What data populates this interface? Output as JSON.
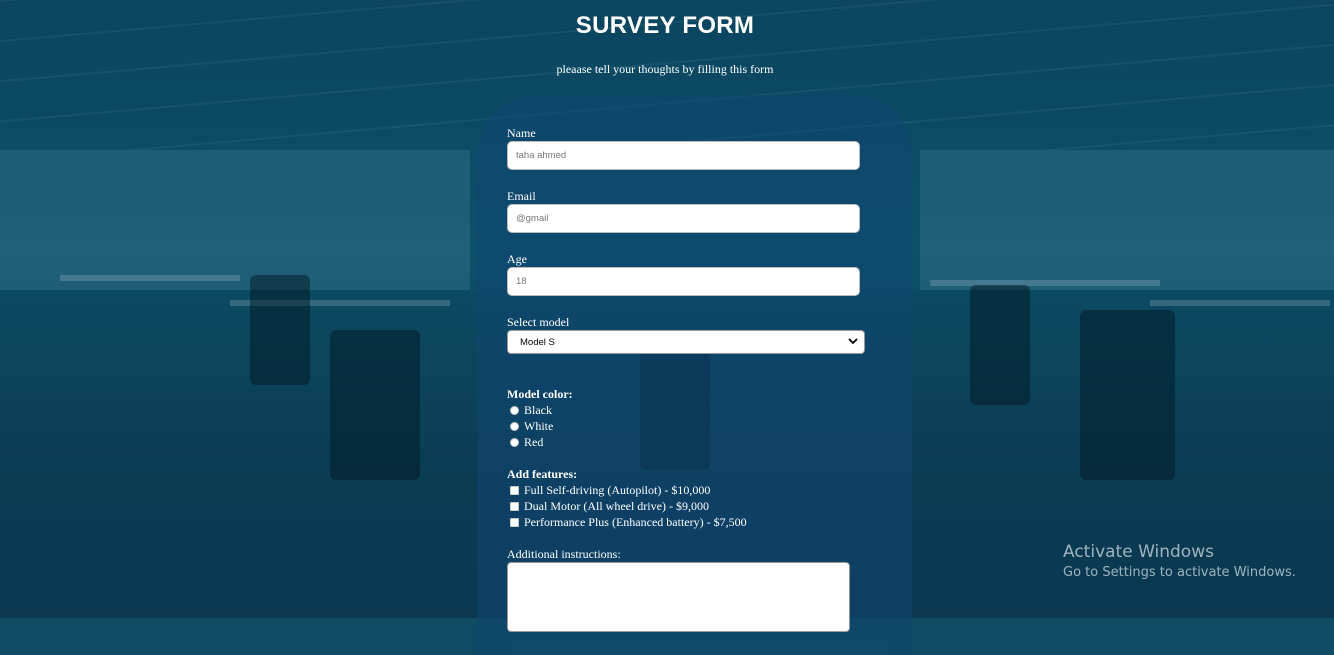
{
  "header": {
    "title": "SURVEY FORM",
    "subtitle": "pleaase tell your thoughts by filling this form"
  },
  "form": {
    "name": {
      "label": "Name",
      "placeholder": "taha ahmed"
    },
    "email": {
      "label": "Email",
      "placeholder": "@gmail"
    },
    "age": {
      "label": "Age",
      "placeholder": "18"
    },
    "model": {
      "label": "Select model",
      "selected": "Model S",
      "icon": "chevron-down-icon"
    },
    "color": {
      "label": "Model color:",
      "options": [
        "Black",
        "White",
        "Red"
      ]
    },
    "features": {
      "label": "Add features:",
      "options": [
        "Full Self-driving (Autopilot) - $10,000",
        "Dual Motor (All wheel drive) - $9,000",
        "Performance Plus (Enhanced battery) - $7,500"
      ]
    },
    "instructions": {
      "label": "Additional instructions:"
    }
  },
  "watermark": {
    "line1": "Activate Windows",
    "line2": "Go to Settings to activate Windows."
  },
  "colors": {
    "background": "#0f4a63",
    "panel": "#10467380"
  }
}
